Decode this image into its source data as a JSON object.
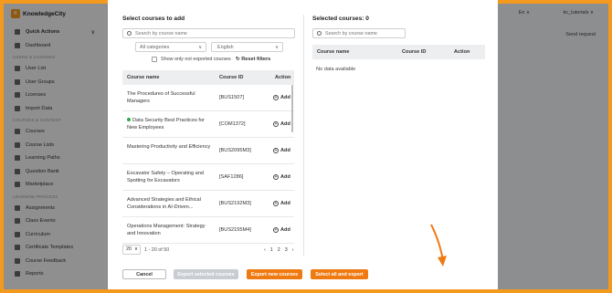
{
  "app": {
    "brand": "KnowledgeCity",
    "logo_letter": "K"
  },
  "header": {
    "language": "En ∨",
    "user": "kc_tutorials ∨",
    "send_request": "Send request"
  },
  "sidebar": {
    "items": [
      {
        "label": "Quick Actions",
        "type": "item",
        "chevron": "∨"
      },
      {
        "label": "Dashboard",
        "type": "item"
      },
      {
        "label": "USERS & LICENSES",
        "type": "section"
      },
      {
        "label": "User List",
        "type": "item"
      },
      {
        "label": "User Groups",
        "type": "item"
      },
      {
        "label": "Licenses",
        "type": "item"
      },
      {
        "label": "Import Data",
        "type": "item"
      },
      {
        "label": "COURSES & CONTENT",
        "type": "section"
      },
      {
        "label": "Courses",
        "type": "item"
      },
      {
        "label": "Course Lists",
        "type": "item"
      },
      {
        "label": "Learning Paths",
        "type": "item"
      },
      {
        "label": "Question Bank",
        "type": "item"
      },
      {
        "label": "Marketplace",
        "type": "item"
      },
      {
        "label": "LEARNING PROCESS",
        "type": "section"
      },
      {
        "label": "Assignments",
        "type": "item"
      },
      {
        "label": "Class Events",
        "type": "item"
      },
      {
        "label": "Curriculum",
        "type": "item"
      },
      {
        "label": "Certificate Templates",
        "type": "item"
      },
      {
        "label": "Course Feedback",
        "type": "item"
      },
      {
        "label": "Reports",
        "type": "item"
      }
    ]
  },
  "modal": {
    "left": {
      "title": "Select courses to add",
      "search_placeholder": "Search by course name",
      "category_select": "All categories",
      "language_select": "English",
      "checkbox_label": "Show only not exported courses",
      "reset_label": "Reset filters",
      "columns": {
        "name": "Course name",
        "id": "Course ID",
        "action": "Action"
      },
      "rows": [
        {
          "name": "The Procedures of Successful Managers",
          "id": "[BUS1507]",
          "action": "Add",
          "badge": false
        },
        {
          "name": "Data Security Best Practices for New Employees",
          "id": "[COM1372]",
          "action": "Add",
          "badge": true
        },
        {
          "name": "Mastering Productivity and Efficiency",
          "id": "[BUS2095M3]",
          "action": "Add",
          "badge": false
        },
        {
          "name": "Excavator Safety – Operating and Spotting for Excavators",
          "id": "[SAF1286]",
          "action": "Add",
          "badge": false
        },
        {
          "name": "Advanced Strategies and Ethical Considerations in AI-Driven...",
          "id": "[BUS2192M3]",
          "action": "Add",
          "badge": false
        },
        {
          "name": "Operations Management: Strategy and Innovation",
          "id": "[BUS2155M4]",
          "action": "Add",
          "badge": false
        }
      ],
      "pagination": {
        "per_page": "20",
        "range": "1 - 20 of 50",
        "pages": [
          "1",
          "2",
          "3"
        ],
        "prev": "‹",
        "next": "›"
      }
    },
    "right": {
      "title": "Selected courses: 0",
      "search_placeholder": "Search by course name",
      "columns": {
        "name": "Course name",
        "id": "Course ID",
        "action": "Action"
      },
      "empty_text": "No data available"
    },
    "buttons": {
      "cancel": "Cancel",
      "export_selected": "Export selected courses",
      "export_new": "Export new courses",
      "select_all": "Select all and export"
    }
  },
  "colors": {
    "accent": "#f07a12",
    "frame": "#f39a1e",
    "disabled": "#c9cdd2",
    "badge": "#2eaa4a"
  }
}
